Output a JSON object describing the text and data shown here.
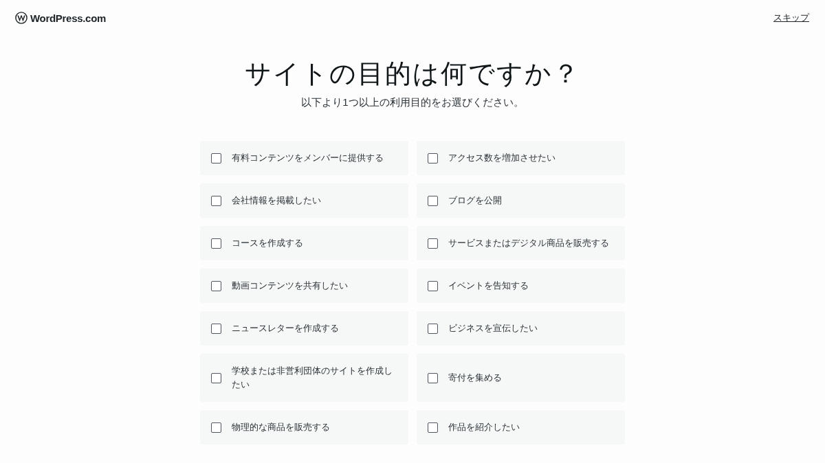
{
  "header": {
    "brand": "WordPress.com",
    "skip_link": "スキップ"
  },
  "heading": {
    "title": "サイトの目的は何ですか？",
    "subtitle": "以下より1つ以上の利用目的をお選びください。"
  },
  "goals": [
    {
      "label": "有料コンテンツをメンバーに提供する",
      "checked": false
    },
    {
      "label": "アクセス数を増加させたい",
      "checked": false
    },
    {
      "label": "会社情報を掲載したい",
      "checked": false
    },
    {
      "label": "ブログを公開",
      "checked": false
    },
    {
      "label": "コースを作成する",
      "checked": false
    },
    {
      "label": "サービスまたはデジタル商品を販売する",
      "checked": false
    },
    {
      "label": "動画コンテンツを共有したい",
      "checked": false
    },
    {
      "label": "イベントを告知する",
      "checked": false
    },
    {
      "label": "ニュースレターを作成する",
      "checked": false
    },
    {
      "label": "ビジネスを宣伝したい",
      "checked": false
    },
    {
      "label": "学校または非営利団体のサイトを作成したい",
      "checked": false
    },
    {
      "label": "寄付を集める",
      "checked": false
    },
    {
      "label": "物理的な商品を販売する",
      "checked": false
    },
    {
      "label": "作品を紹介したい",
      "checked": false
    }
  ]
}
